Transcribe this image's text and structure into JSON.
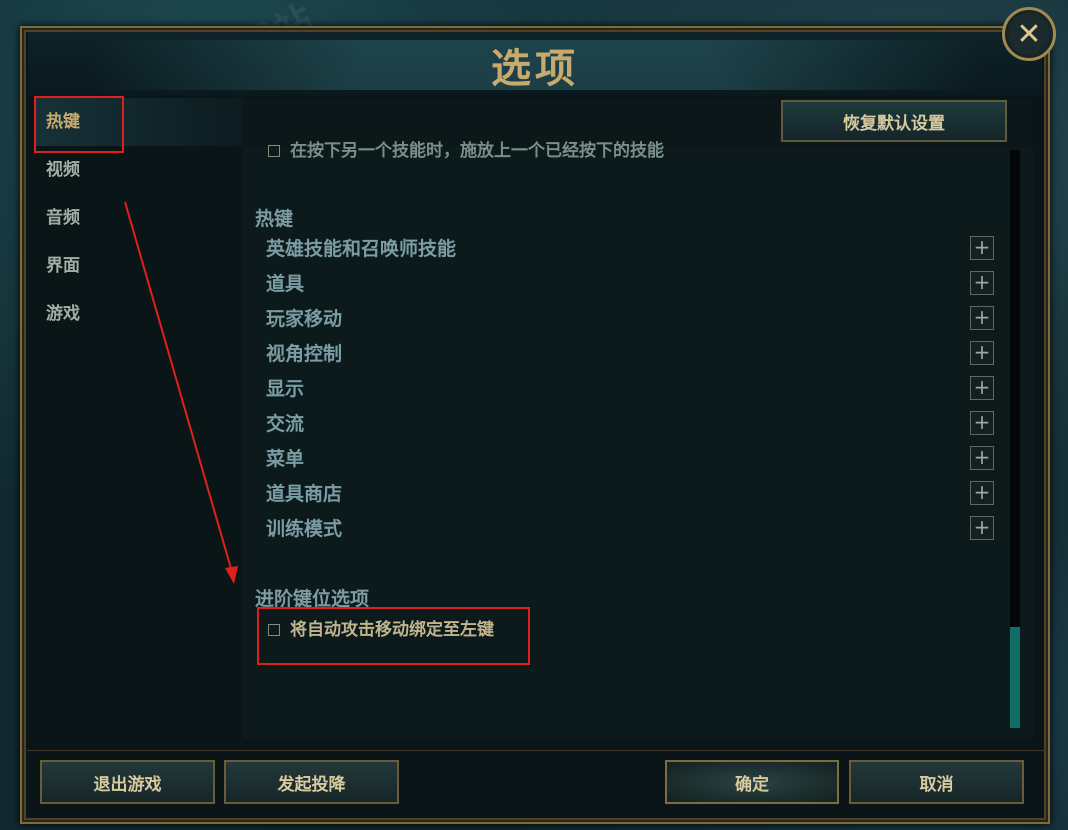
{
  "window": {
    "title": "选项",
    "close_symbol": "✕",
    "watermark": "天极下载站"
  },
  "sidebar": {
    "items": [
      {
        "label": "热键",
        "active": true
      },
      {
        "label": "视频",
        "active": false
      },
      {
        "label": "音频",
        "active": false
      },
      {
        "label": "界面",
        "active": false
      },
      {
        "label": "游戏",
        "active": false
      }
    ]
  },
  "content": {
    "reset_label": "恢复默认设置",
    "partial_option": "在按下另一个技能时，施放上一个已经按下的技能",
    "hotkeys_title": "热键",
    "hotkey_groups": [
      "英雄技能和召唤师技能",
      "道具",
      "玩家移动",
      "视角控制",
      "显示",
      "交流",
      "菜单",
      "道具商店",
      "训练模式"
    ],
    "expand_symbol": "+",
    "advanced_title": "进阶键位选项",
    "advanced_option": "将自动攻击移动绑定至左键"
  },
  "footer": {
    "quit_label": "退出游戏",
    "surrender_label": "发起投降",
    "ok_label": "确定",
    "cancel_label": "取消"
  },
  "colors": {
    "gold": "#c8aa6e",
    "annotation_red": "#e0201e",
    "scroll_thumb": "#0f6e66"
  }
}
